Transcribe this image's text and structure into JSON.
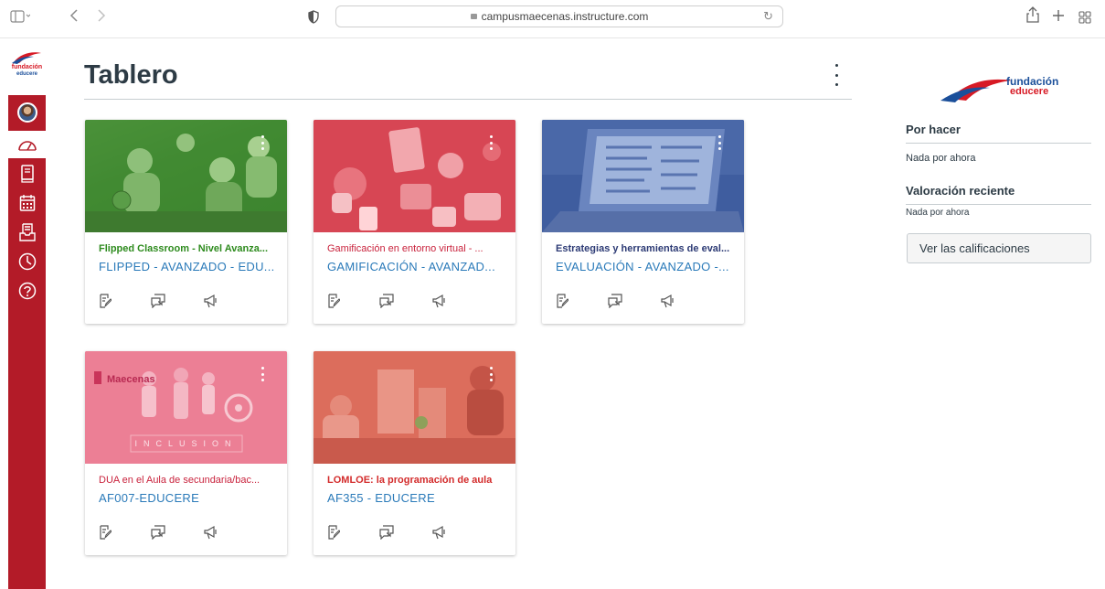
{
  "browser": {
    "url": "campusmaecenas.instructure.com"
  },
  "nav": {
    "logo_line1": "fundación",
    "logo_line2": "educere"
  },
  "main": {
    "title": "Tablero"
  },
  "cards": [
    {
      "title": "Flipped Classroom - Nivel Avanza...",
      "code": "FLIPPED - AVANZADO - EDU...",
      "title_color": "#2e8b1e"
    },
    {
      "title": "Gamificación en entorno virtual - ...",
      "code": "GAMIFICACIÓN - AVANZAD...",
      "title_color": "#c9233d"
    },
    {
      "title": "Estrategias y herramientas de eval...",
      "code": "EVALUACIÓN - AVANZADO -...",
      "title_color": "#2d3b75"
    },
    {
      "title": "DUA en el Aula de secundaria/bac...",
      "code": "AF007-EDUCERE",
      "title_color": "#c9233d",
      "image_text": "Maecenas",
      "image_caption": "INCLUSION"
    },
    {
      "title": "LOMLOE: la programación de aula",
      "code": "AF355 - EDUCERE",
      "title_color": "#d32b2b"
    }
  ],
  "sidebar": {
    "brand_line1": "fundación",
    "brand_line2": "educere",
    "todo_heading": "Por hacer",
    "todo_empty": "Nada por ahora",
    "feedback_heading": "Valoración reciente",
    "feedback_empty": "Nada por ahora",
    "grades_button": "Ver las calificaciones"
  }
}
